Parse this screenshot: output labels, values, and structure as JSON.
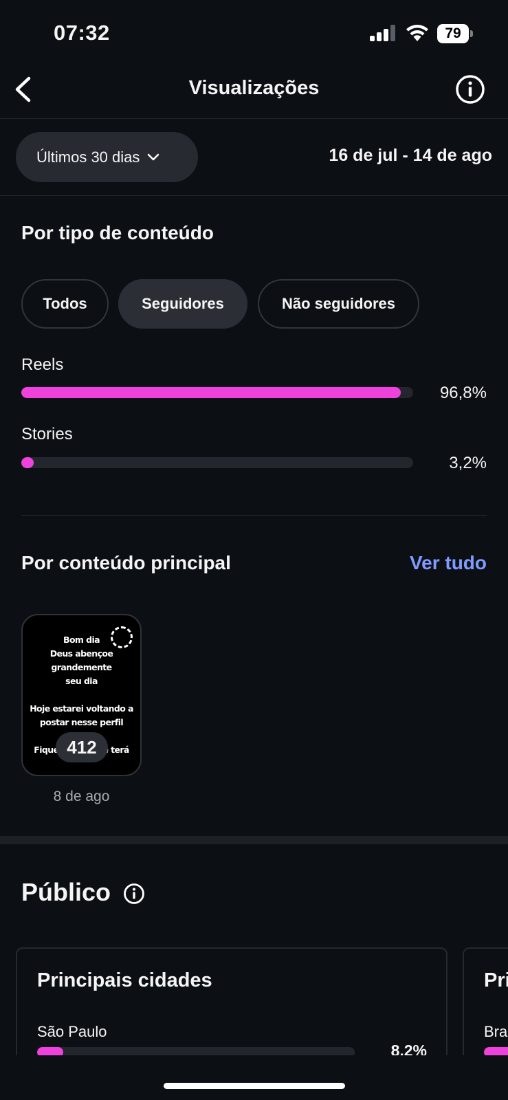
{
  "status_bar": {
    "time": "07:32",
    "battery": "79"
  },
  "header": {
    "title": "Visualizações"
  },
  "period": {
    "selected": "Últimos 30 dias",
    "date_range": "16 de jul - 14 de ago"
  },
  "content_type": {
    "title": "Por tipo de conteúdo",
    "filters": [
      "Todos",
      "Seguidores",
      "Não seguidores"
    ],
    "active_filter": "Seguidores",
    "bars": [
      {
        "label": "Reels",
        "percent_text": "96,8%",
        "value": 96.8
      },
      {
        "label": "Stories",
        "percent_text": "3,2%",
        "value": 3.2
      }
    ],
    "bar_color": "#ef42dc"
  },
  "top_content": {
    "title": "Por conteúdo principal",
    "see_all": "Ver tudo",
    "items": [
      {
        "text_lines": [
          "Bom dia",
          "Deus abençoe grandemente",
          "seu dia",
          "",
          "Hoje estarei voltando a",
          "postar nesse perfil",
          "",
          "Fique ligado que terá"
        ],
        "views": "412",
        "date": "8 de ago"
      }
    ]
  },
  "audience": {
    "title": "Público",
    "cards": [
      {
        "title": "Principais cidades",
        "rows": [
          {
            "label": "São Paulo",
            "percent_text": "8,2%",
            "value": 8.2
          }
        ]
      },
      {
        "title": "Pri",
        "rows": [
          {
            "label": "Bra",
            "percent_text": "",
            "value": 8
          }
        ]
      }
    ]
  },
  "colors": {
    "accent_link": "#7f9bff",
    "background": "#0c0f14"
  }
}
